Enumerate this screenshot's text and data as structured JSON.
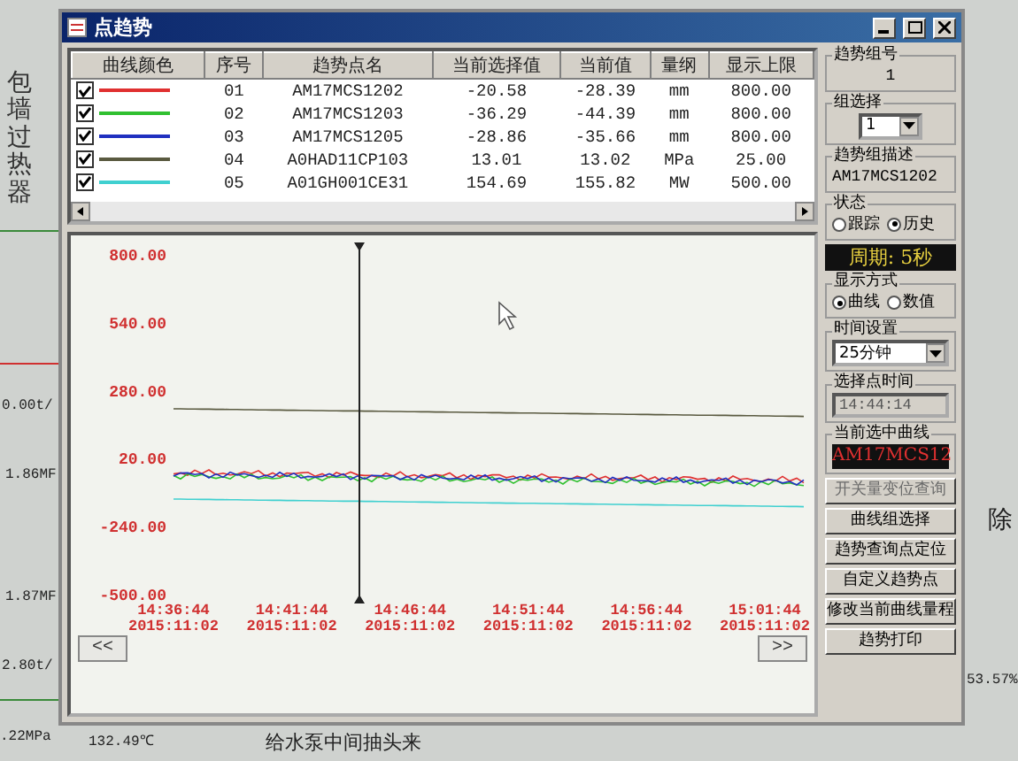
{
  "window": {
    "title": "点趋势"
  },
  "backdrop": {
    "left_labels": [
      "包墙过热器",
      "0.00t/",
      "1.86MF",
      "1.87MF",
      "2.80t/",
      ".22MPa",
      "132.49℃"
    ],
    "bottom_label": "给水泵中间抽头来",
    "right_labels": [
      "除",
      "53.57%"
    ]
  },
  "table": {
    "columns": [
      "曲线颜色",
      "序号",
      "趋势点名",
      "当前选择值",
      "当前值",
      "量纲",
      "显示上限"
    ],
    "rows": [
      {
        "checked": true,
        "color": "#e03030",
        "number": "01",
        "point_name": "AM17MCS1202",
        "selected_value": "-20.58",
        "current_value": "-28.39",
        "unit": "mm",
        "upper_limit": "800.00"
      },
      {
        "checked": true,
        "color": "#30c030",
        "number": "02",
        "point_name": "AM17MCS1203",
        "selected_value": "-36.29",
        "current_value": "-44.39",
        "unit": "mm",
        "upper_limit": "800.00"
      },
      {
        "checked": true,
        "color": "#2030c0",
        "number": "03",
        "point_name": "AM17MCS1205",
        "selected_value": "-28.86",
        "current_value": "-35.66",
        "unit": "mm",
        "upper_limit": "800.00"
      },
      {
        "checked": true,
        "color": "#5a5a40",
        "number": "04",
        "point_name": "A0HAD11CP103",
        "selected_value": "13.01",
        "current_value": "13.02",
        "unit": "MPa",
        "upper_limit": "25.00"
      },
      {
        "checked": true,
        "color": "#40d0d0",
        "number": "05",
        "point_name": "A01GH001CE31",
        "selected_value": "154.69",
        "current_value": "155.82",
        "unit": "MW",
        "upper_limit": "500.00"
      }
    ]
  },
  "chart": {
    "y_labels": [
      "800.00",
      "540.00",
      "280.00",
      "20.00",
      "-240.00",
      "-500.00"
    ],
    "time_labels": [
      {
        "time": "14:36:44",
        "date": "2015:11:02"
      },
      {
        "time": "14:41:44",
        "date": "2015:11:02"
      },
      {
        "time": "14:46:44",
        "date": "2015:11:02"
      },
      {
        "time": "14:51:44",
        "date": "2015:11:02"
      },
      {
        "time": "14:56:44",
        "date": "2015:11:02"
      },
      {
        "time": "15:01:44",
        "date": "2015:11:02"
      }
    ],
    "prev_button": "<<",
    "next_button": ">>"
  },
  "panel": {
    "group_number": {
      "label": "趋势组号",
      "value": "1"
    },
    "group_select": {
      "label": "组选择",
      "value": "1"
    },
    "group_desc": {
      "label": "趋势组描述",
      "value": "AM17MCS1202"
    },
    "status": {
      "label": "状态",
      "options": [
        {
          "label": "跟踪",
          "selected": false
        },
        {
          "label": "历史",
          "selected": true
        }
      ]
    },
    "period": "周期: 5秒",
    "display_mode": {
      "label": "显示方式",
      "options": [
        {
          "label": "曲线",
          "selected": true
        },
        {
          "label": "数值",
          "selected": false
        }
      ]
    },
    "time_setting": {
      "label": "时间设置",
      "value": "25分钟"
    },
    "point_time": {
      "label": "选择点时间",
      "value": "14:44:14",
      "disabled": true
    },
    "current_curve": {
      "label": "当前选中曲线",
      "value": "AM17MCS12"
    },
    "buttons": [
      {
        "label": "开关量变位查询",
        "disabled": true
      },
      {
        "label": "曲线组选择",
        "disabled": false
      },
      {
        "label": "趋势查询点定位",
        "disabled": false
      },
      {
        "label": "自定义趋势点",
        "disabled": false
      },
      {
        "label": "修改当前曲线量程",
        "disabled": false
      },
      {
        "label": "趋势打印",
        "disabled": false
      }
    ]
  }
}
